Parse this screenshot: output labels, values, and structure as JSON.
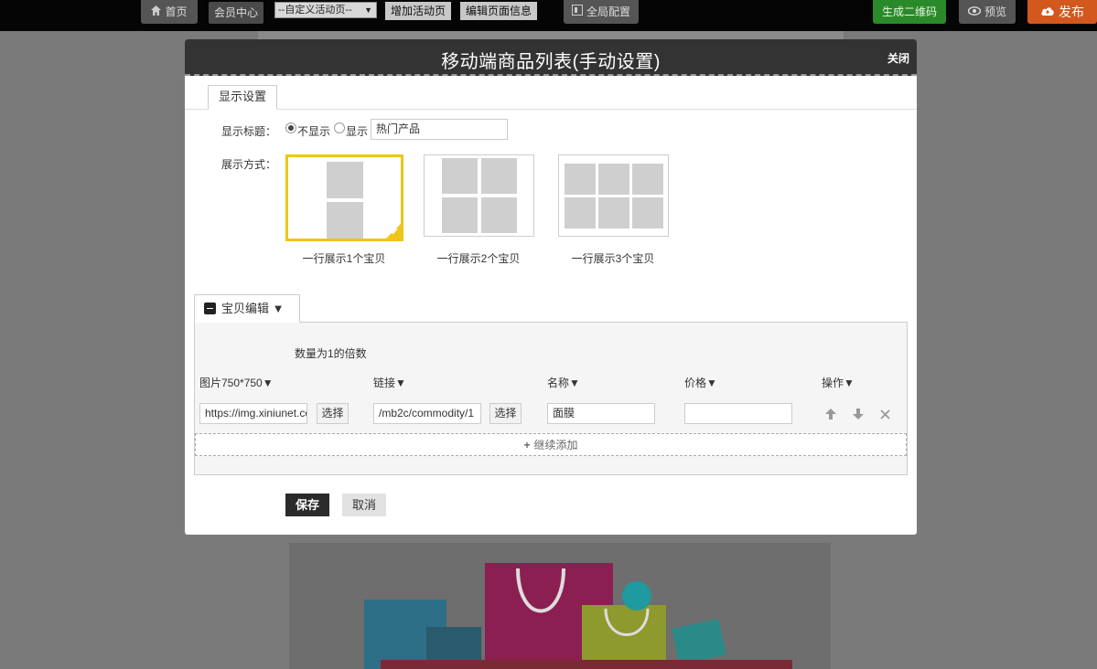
{
  "toolbar": {
    "home_label": "首页",
    "member_label": "会员中心",
    "page_select_value": "--自定义活动页--",
    "add_page_label": "增加活动页",
    "edit_page_label": "编辑页面信息",
    "global_label": "全局配置",
    "qrcode_label": "生成二维码",
    "preview_label": "预览",
    "publish_label": "发布"
  },
  "modal": {
    "title": "移动端商品列表(手动设置)",
    "close_label": "关闭",
    "tab_label": "显示设置",
    "show_title_label": "显示标题：",
    "radio_hide_label": "不显示",
    "radio_show_label": "显示",
    "title_input_value": "热门产品",
    "display_mode_label": "展示方式：",
    "layouts": [
      {
        "caption": "一行展示1个宝贝",
        "selected": true
      },
      {
        "caption": "一行展示2个宝贝",
        "selected": false
      },
      {
        "caption": "一行展示3个宝贝",
        "selected": false
      }
    ],
    "edit_section_label": "宝贝编辑 ▼",
    "quantity_hint": "数量为1的倍数",
    "columns": {
      "image": "图片750*750▼",
      "link": "链接▼",
      "name": "名称▼",
      "price": "价格▼",
      "actions": "操作▼"
    },
    "row": {
      "image_value": "https://img.xiniunet.com",
      "link_value": "/mb2c/commodity/1",
      "name_value": "面膜",
      "price_value": "",
      "select_label": "选择"
    },
    "add_more_label": "继续添加",
    "save_label": "保存",
    "cancel_label": "取消"
  },
  "colors": {
    "selected_border": "#f0c419",
    "qrcode_bg": "#2a8a2a",
    "publish_bg": "#d2581e",
    "modal_header_bg": "#333333"
  }
}
